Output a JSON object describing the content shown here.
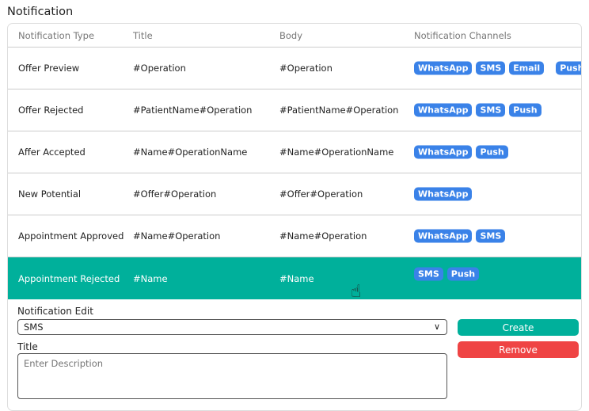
{
  "page_title": "Notification",
  "columns": [
    "Notification Type",
    "Title",
    "Body",
    "Notification Channels"
  ],
  "rows": [
    {
      "type": "Offer Preview",
      "title": "#Operation",
      "body": "#Operation",
      "channels": [
        "WhatsApp",
        "SMS",
        "Email",
        "Push"
      ]
    },
    {
      "type": "Offer Rejected",
      "title": "#PatientName#Operation",
      "body": "#PatientName#Operation",
      "channels": [
        "WhatsApp",
        "SMS",
        "Push"
      ]
    },
    {
      "type": "Affer Accepted",
      "title": "#Name#OperationName",
      "body": "#Name#OperationName",
      "channels": [
        "WhatsApp",
        "Push"
      ]
    },
    {
      "type": "New Potential",
      "title": "#Offer#Operation",
      "body": "#Offer#Operation",
      "channels": [
        "WhatsApp"
      ]
    },
    {
      "type": "Appointment Approved",
      "title": "#Name#Operation",
      "body": "#Name#Operation",
      "channels": [
        "WhatsApp",
        "SMS"
      ]
    },
    {
      "type": "Appointment Rejected",
      "title": "#Name",
      "body": "#Name",
      "channels": [
        "SMS",
        "Push"
      ],
      "selected": true
    }
  ],
  "edit": {
    "label": "Notification Edit",
    "select_value": "SMS",
    "title_label": "Title",
    "title_placeholder": "Enter Description",
    "create_label": "Create",
    "remove_label": "Remove"
  },
  "colors": {
    "accent": "#00b09b",
    "badge": "#3a82e8",
    "danger": "#ef4444"
  }
}
